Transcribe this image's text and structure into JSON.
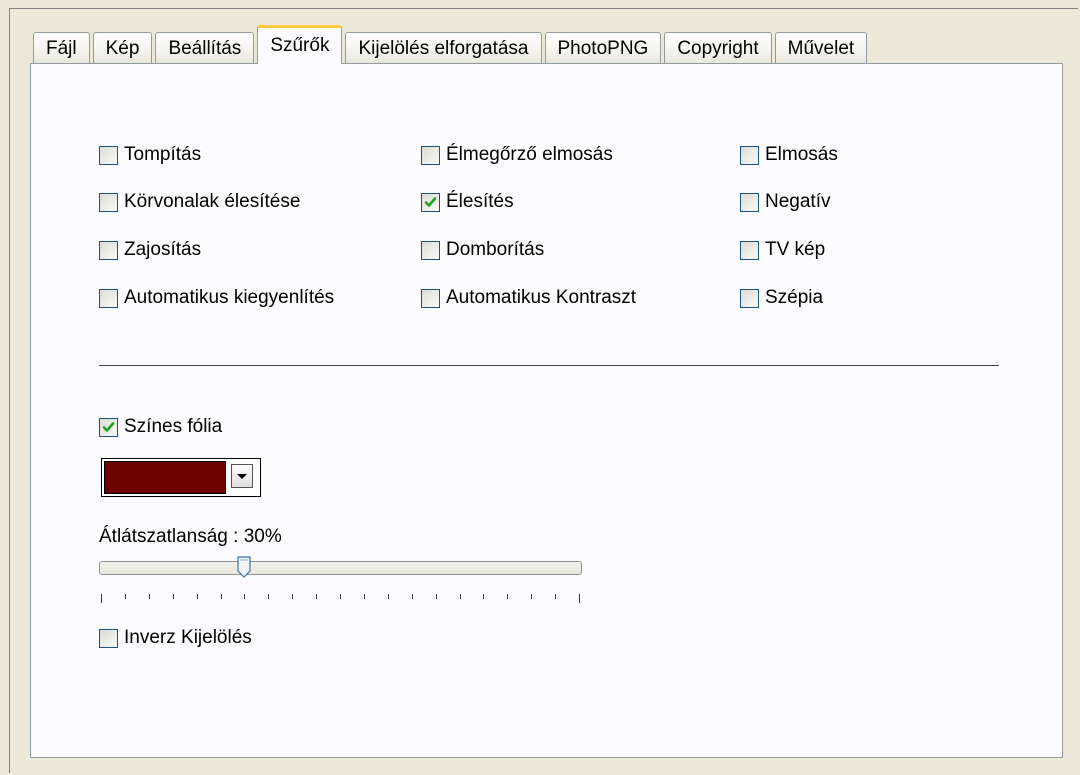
{
  "tabs": [
    {
      "label": "Fájl"
    },
    {
      "label": "Kép"
    },
    {
      "label": "Beállítás"
    },
    {
      "label": "Szűrők",
      "active": true
    },
    {
      "label": "Kijelölés elforgatása"
    },
    {
      "label": "PhotoPNG"
    },
    {
      "label": "Copyright"
    },
    {
      "label": "Művelet"
    }
  ],
  "filters": {
    "col1": [
      {
        "label": "Tompítás",
        "checked": false
      },
      {
        "label": "Körvonalak élesítése",
        "checked": false
      },
      {
        "label": "Zajosítás",
        "checked": false
      },
      {
        "label": "Automatikus kiegyenlítés",
        "checked": false
      }
    ],
    "col2": [
      {
        "label": "Élmegőrző elmosás",
        "checked": false
      },
      {
        "label": "Élesítés",
        "checked": true
      },
      {
        "label": "Domborítás",
        "checked": false
      },
      {
        "label": "Automatikus Kontraszt",
        "checked": false
      }
    ],
    "col3": [
      {
        "label": "Elmosás",
        "checked": false
      },
      {
        "label": "Negatív",
        "checked": false
      },
      {
        "label": "TV kép",
        "checked": false
      },
      {
        "label": "Szépia",
        "checked": false
      }
    ]
  },
  "color_foil": {
    "label": "Színes fólia",
    "checked": true,
    "color": "#6e0000"
  },
  "opacity": {
    "label": "Átlátszatlanság : 30%",
    "value_percent": 30
  },
  "inverse_selection": {
    "label": "Inverz Kijelölés",
    "checked": false
  },
  "colors": {
    "check": "#21a121",
    "checkbox_border": "#1c5180",
    "active_tab_accent": "#ffc83c"
  }
}
